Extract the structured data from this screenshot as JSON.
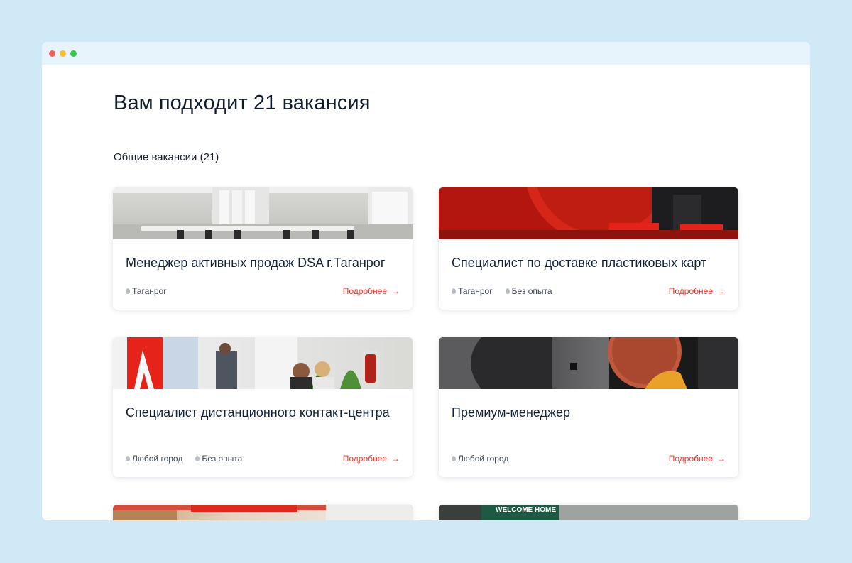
{
  "window": {
    "controls": [
      "close",
      "minimize",
      "maximize"
    ]
  },
  "page": {
    "title": "Вам подходит 21 вакансия",
    "section_title": "Общие вакансии (21)"
  },
  "colors": {
    "accent": "#ef3124",
    "background": "#cfe9f7",
    "titlebar": "#e8f4fb"
  },
  "vacancies": [
    {
      "title": "Менеджер активных продаж DSA г.Таганрог",
      "city": "Таганрог",
      "experience": "",
      "more_label": "Подробнее",
      "image": "office-photo"
    },
    {
      "title": "Специалист по доставке пластиковых карт",
      "city": "Таганрог",
      "experience": "Без опыта",
      "more_label": "Подробнее",
      "image": "red-lounge-photo"
    },
    {
      "title": "Специалист дистанционного контакт-центра",
      "city": "Любой город",
      "experience": "Без опыта",
      "more_label": "Подробнее",
      "image": "people-office-photo"
    },
    {
      "title": "Премиум-менеджер",
      "city": "Любой город",
      "experience": "",
      "more_label": "Подробнее",
      "image": "dark-lounge-photo"
    },
    {
      "title": "",
      "city": "",
      "experience": "",
      "more_label": "",
      "image": "wood-office-photo"
    },
    {
      "title": "",
      "city": "",
      "experience": "",
      "more_label": "",
      "image": "welcome-home-photo",
      "image_text": "WELCOME HOME"
    }
  ]
}
